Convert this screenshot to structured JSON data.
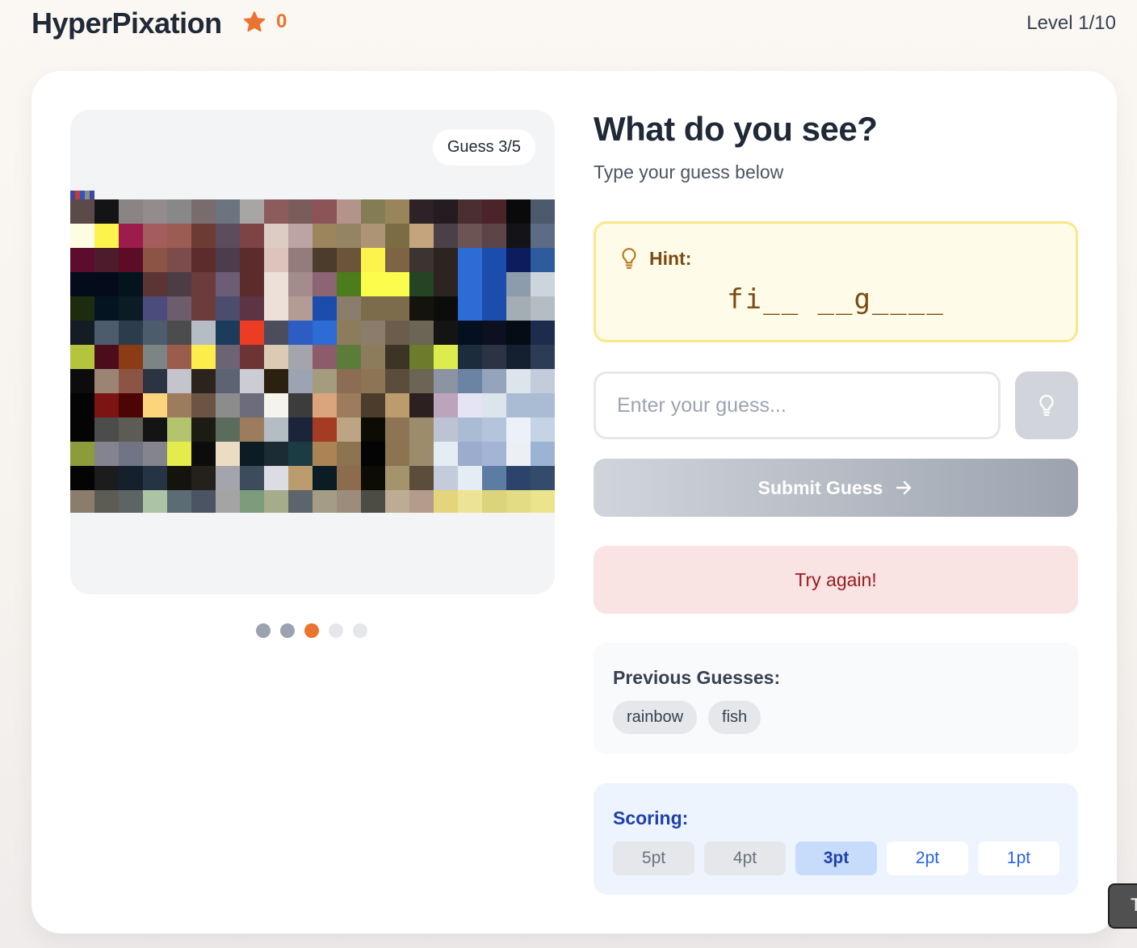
{
  "header": {
    "app_title": "HyperPixation",
    "score": "0",
    "level": "Level 1/10"
  },
  "image_panel": {
    "guess_counter": "Guess 3/5",
    "progress_dots": [
      "done",
      "done",
      "current",
      "future",
      "future"
    ],
    "pixel_rows": [
      [
        "#5c4a4a",
        "#141416",
        "#8a8484",
        "#948c8c",
        "#888888",
        "#7a6c6c",
        "#6c7480",
        "#a8a6a4",
        "#8c5c5c",
        "#7a5c5c",
        "#8c5456",
        "#b4948a",
        "#847c54",
        "#9a845c",
        "#2e2226",
        "#251c22",
        "#4a2e32",
        "#4a2428",
        "#0a0a0a",
        "#4c5a6c"
      ],
      [
        "#fffce4",
        "#fcf44c",
        "#9c1c4c",
        "#a45c5c",
        "#9c5c54",
        "#6c3c34",
        "#5c4c5c",
        "#7c4444",
        "#dcccc4",
        "#bca4a4",
        "#9c845c",
        "#948464",
        "#ac9474",
        "#7c6c44",
        "#c4a47c",
        "#4c4048",
        "#6c5454",
        "#5c4448",
        "#141418",
        "#5c6c84"
      ],
      [
        "#5c0c2c",
        "#4c1c2c",
        "#5c0c24",
        "#8c5444",
        "#7c4c4c",
        "#5c2c2c",
        "#4c3c4c",
        "#5c2c2c",
        "#dcc4bc",
        "#947c7c",
        "#4c3c2c",
        "#6c5438",
        "#fcf44c",
        "#7c6444",
        "#3c3430",
        "#2c2420",
        "#2c6cd4",
        "#1c4cac",
        "#0c1c5c",
        "#2c5c9c"
      ],
      [
        "#040c1c",
        "#040c1c",
        "#04141c",
        "#5c3434",
        "#4c3c44",
        "#6c3c3c",
        "#6c5c74",
        "#5c2c2c",
        "#ece0d8",
        "#a48c8c",
        "#8c6474",
        "#4c7c1c",
        "#fcfc4c",
        "#fcfc4c",
        "#244424",
        "#2c2420",
        "#2c6cd4",
        "#1c4cac",
        "#8c9cac",
        "#ccd4dc"
      ],
      [
        "#1c2c0c",
        "#041420",
        "#0c1c24",
        "#4c4c7c",
        "#6c5c6c",
        "#6c3c3c",
        "#4c4c6c",
        "#5c3444",
        "#ece0d8",
        "#b49c94",
        "#1c4cac",
        "#8c7c6c",
        "#7c6c4c",
        "#7c6c4c",
        "#14140c",
        "#0c0c0c",
        "#2c6cd4",
        "#1c4cac",
        "#a4acb4",
        "#b4bcc4"
      ],
      [
        "#141c24",
        "#4c5c6c",
        "#2c3c4c",
        "#4c5c6c",
        "#4c4c4c",
        "#b4bcc4",
        "#1c3c5c",
        "#ec3c24",
        "#4c4c5c",
        "#2c5cc4",
        "#2c6cd4",
        "#8c7c5c",
        "#8c7c6c",
        "#6c5c4c",
        "#6c6454",
        "#141414",
        "#041020",
        "#0c1020",
        "#040c14",
        "#1c2c4c"
      ],
      [
        "#b4c43c",
        "#4c0c1c",
        "#8c3c14",
        "#7c8484",
        "#9c5c4c",
        "#fcec4c",
        "#6c6474",
        "#6c3434",
        "#dccab4",
        "#a4a4ac",
        "#8c5c6c",
        "#5c7c3c",
        "#8c7c5c",
        "#3c3424",
        "#6c7c2c",
        "#dcec4c",
        "#1c2c3c",
        "#2c3444",
        "#142030",
        "#2c3c54"
      ],
      [
        "#0c0c0c",
        "#9c8474",
        "#8c5444",
        "#2c3444",
        "#c4c4cc",
        "#2c241c",
        "#5c6474",
        "#ccccd4",
        "#2c2010",
        "#9ca4b4",
        "#a49c7c",
        "#8c6c54",
        "#8c7454",
        "#5c4c3c",
        "#6c6454",
        "#8c94a4",
        "#6c84a4",
        "#94a4bc",
        "#dce4ec",
        "#c4ccdc"
      ],
      [
        "#040404",
        "#7c1414",
        "#4c0404",
        "#fcd47c",
        "#9c7c5c",
        "#6c5444",
        "#8c8c8c",
        "#6c6c7c",
        "#f4f4ec",
        "#3c3c3c",
        "#dca47c",
        "#9c7c5c",
        "#4c3c2c",
        "#bc9c6c",
        "#2c2020",
        "#bca4bc",
        "#e4e4f4",
        "#dce4ec",
        "#aabcd4",
        "#aabcd4"
      ],
      [
        "#040404",
        "#4c4c4c",
        "#5c5c54",
        "#141414",
        "#b4c46c",
        "#1c1c14",
        "#5c6c5c",
        "#9c7c5c",
        "#b4bcc4",
        "#1c243c",
        "#a43c24",
        "#bca484",
        "#0c0c04",
        "#8c7454",
        "#9c8c6c",
        "#bcc4d4",
        "#aabcd4",
        "#b4c4dc",
        "#ecf0f8",
        "#c4d4e4"
      ],
      [
        "#8c9c3c",
        "#848490",
        "#707484",
        "#84848c",
        "#e4ec4c",
        "#0c0c0c",
        "#ecdcc4",
        "#0c1c24",
        "#1c2c34",
        "#1c3c44",
        "#ac8454",
        "#8c7450",
        "#040404",
        "#8c7450",
        "#9c8c6c",
        "#e4ecf4",
        "#9caccc",
        "#a4b4d4",
        "#eceff4",
        "#9cb4d4"
      ],
      [
        "#040404",
        "#1c1c1c",
        "#14202c",
        "#243444",
        "#14140c",
        "#24201c",
        "#a4a4ac",
        "#3c4c5c",
        "#dcdce4",
        "#bc9c6c",
        "#0c1c24",
        "#8c6c4c",
        "#0c0c04",
        "#a4946c",
        "#5c4c3c",
        "#c4ccdc",
        "#e4ecf4",
        "#5c7ca4",
        "#2c446c",
        "#344c6c"
      ],
      [
        "#8c7c6c",
        "#5c5c54",
        "#5c6464",
        "#acc4a4",
        "#5c6c74",
        "#4c5464",
        "#a4a4a4",
        "#7c9c7c",
        "#a4ac8c",
        "#5c646c",
        "#a49c84",
        "#9c8c7c",
        "#4c4c44",
        "#bcac94",
        "#b49c8c",
        "#e4d47c",
        "#ece494",
        "#dcd47c",
        "#e4dc84",
        "#ece48c"
      ]
    ]
  },
  "main": {
    "heading": "What do you see?",
    "subheading": "Type your guess below",
    "hint": {
      "label": "Hint:",
      "pattern": "fi__ __g____"
    },
    "input": {
      "placeholder": "Enter your guess...",
      "value": ""
    },
    "submit_label": "Submit Guess",
    "feedback": "Try again!",
    "previous_guesses": {
      "title": "Previous Guesses:",
      "items": [
        "rainbow",
        "fish"
      ]
    },
    "scoring": {
      "title": "Scoring:",
      "points": [
        {
          "label": "5pt",
          "state": "used"
        },
        {
          "label": "4pt",
          "state": "used"
        },
        {
          "label": "3pt",
          "state": "current"
        },
        {
          "label": "2pt",
          "state": "upcoming"
        },
        {
          "label": "1pt",
          "state": "upcoming"
        }
      ]
    }
  },
  "colors": {
    "accent": "#ea7330",
    "hint_text": "#7c4a12",
    "error_text": "#991b1b",
    "scoring_blue": "#1e40af"
  },
  "icons": {
    "score": "star-icon",
    "hint": "lightbulb-icon",
    "hint_button": "lightbulb-icon",
    "submit": "arrow-right-icon"
  },
  "edge_widget": {
    "label": "T"
  }
}
